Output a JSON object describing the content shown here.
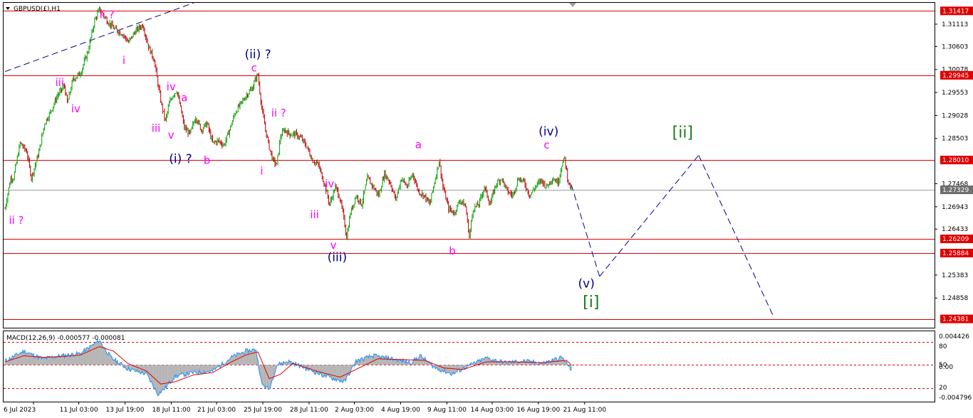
{
  "symbol_title": "GBPUSD(£),H1",
  "colors": {
    "bull": "#00a000",
    "bear": "#c00000",
    "level": "#e00000",
    "current": "#a0a0a0",
    "wave_blue": "#00008b",
    "wave_pink": "#ff00ff",
    "wave_green": "#1a7a1a",
    "projection": "#00008b",
    "macd_hist": "#b4b4b4",
    "macd_signal": "#e00000",
    "macd_line": "#1e90ff"
  },
  "chart_data": [
    {
      "type": "candlestick",
      "symbol": "GBPUSD(£),H1",
      "ylim": [
        1.2418,
        1.316
      ],
      "x_ticks": [
        "6 Jul 2023",
        "11 Jul 03:00",
        "13 Jul 19:00",
        "18 Jul 11:00",
        "21 Jul 03:00",
        "25 Jul 19:00",
        "28 Jul 11:00",
        "2 Aug 03:00",
        "4 Aug 19:00",
        "9 Aug 11:00",
        "14 Aug 03:00",
        "16 Aug 19:00",
        "21 Aug 11:00"
      ],
      "y_ticks": [
        "1.31113",
        "1.30603",
        "1.30078",
        "1.29553",
        "1.29028",
        "1.28503",
        "1.27468",
        "1.26943",
        "1.26433",
        "1.25383",
        "1.24858"
      ],
      "levels": [
        {
          "price": 1.31417,
          "label": "1.31417"
        },
        {
          "price": 1.29945,
          "label": "1.29945"
        },
        {
          "price": 1.2801,
          "label": "1.28010"
        },
        {
          "price": 1.26209,
          "label": "1.26209"
        },
        {
          "price": 1.25884,
          "label": "1.25884"
        },
        {
          "price": 1.24381,
          "label": "1.24381"
        }
      ],
      "current_price": {
        "price": 1.27329,
        "label": "1.27329"
      },
      "path_points": [
        {
          "i": 0,
          "price": 1.269
        },
        {
          "i": 6,
          "price": 1.276
        },
        {
          "i": 9,
          "price": 1.276
        },
        {
          "i": 16,
          "price": 1.284
        },
        {
          "i": 23,
          "price": 1.282
        },
        {
          "i": 28,
          "price": 1.276
        },
        {
          "i": 36,
          "price": 1.282
        },
        {
          "i": 42,
          "price": 1.2885
        },
        {
          "i": 48,
          "price": 1.291
        },
        {
          "i": 56,
          "price": 1.295
        },
        {
          "i": 63,
          "price": 1.297
        },
        {
          "i": 66,
          "price": 1.293
        },
        {
          "i": 72,
          "price": 1.2985
        },
        {
          "i": 80,
          "price": 1.3
        },
        {
          "i": 88,
          "price": 1.305
        },
        {
          "i": 95,
          "price": 1.312
        },
        {
          "i": 100,
          "price": 1.3145
        },
        {
          "i": 108,
          "price": 1.312
        },
        {
          "i": 116,
          "price": 1.31
        },
        {
          "i": 124,
          "price": 1.309
        },
        {
          "i": 131,
          "price": 1.307
        },
        {
          "i": 138,
          "price": 1.3095
        },
        {
          "i": 146,
          "price": 1.311
        },
        {
          "i": 152,
          "price": 1.306
        },
        {
          "i": 158,
          "price": 1.303
        },
        {
          "i": 162,
          "price": 1.2975
        },
        {
          "i": 166,
          "price": 1.2925
        },
        {
          "i": 170,
          "price": 1.289
        },
        {
          "i": 174,
          "price": 1.293
        },
        {
          "i": 178,
          "price": 1.295
        },
        {
          "i": 182,
          "price": 1.296
        },
        {
          "i": 186,
          "price": 1.292
        },
        {
          "i": 190,
          "price": 1.2875
        },
        {
          "i": 196,
          "price": 1.286
        },
        {
          "i": 202,
          "price": 1.29
        },
        {
          "i": 208,
          "price": 1.287
        },
        {
          "i": 214,
          "price": 1.2885
        },
        {
          "i": 220,
          "price": 1.284
        },
        {
          "i": 226,
          "price": 1.2845
        },
        {
          "i": 232,
          "price": 1.2835
        },
        {
          "i": 238,
          "price": 1.287
        },
        {
          "i": 244,
          "price": 1.291
        },
        {
          "i": 250,
          "price": 1.293
        },
        {
          "i": 256,
          "price": 1.295
        },
        {
          "i": 262,
          "price": 1.2965
        },
        {
          "i": 266,
          "price": 1.299
        },
        {
          "i": 268,
          "price": 1.2995
        },
        {
          "i": 272,
          "price": 1.292
        },
        {
          "i": 276,
          "price": 1.287
        },
        {
          "i": 280,
          "price": 1.283
        },
        {
          "i": 284,
          "price": 1.28
        },
        {
          "i": 288,
          "price": 1.279
        },
        {
          "i": 292,
          "price": 1.2855
        },
        {
          "i": 296,
          "price": 1.287
        },
        {
          "i": 302,
          "price": 1.286
        },
        {
          "i": 308,
          "price": 1.286
        },
        {
          "i": 314,
          "price": 1.285
        },
        {
          "i": 320,
          "price": 1.283
        },
        {
          "i": 326,
          "price": 1.28
        },
        {
          "i": 332,
          "price": 1.279
        },
        {
          "i": 338,
          "price": 1.275
        },
        {
          "i": 344,
          "price": 1.27
        },
        {
          "i": 350,
          "price": 1.274
        },
        {
          "i": 354,
          "price": 1.272
        },
        {
          "i": 358,
          "price": 1.268
        },
        {
          "i": 362,
          "price": 1.2625
        },
        {
          "i": 366,
          "price": 1.268
        },
        {
          "i": 372,
          "price": 1.272
        },
        {
          "i": 378,
          "price": 1.27
        },
        {
          "i": 384,
          "price": 1.276
        },
        {
          "i": 390,
          "price": 1.274
        },
        {
          "i": 396,
          "price": 1.272
        },
        {
          "i": 402,
          "price": 1.277
        },
        {
          "i": 408,
          "price": 1.275
        },
        {
          "i": 414,
          "price": 1.271
        },
        {
          "i": 420,
          "price": 1.276
        },
        {
          "i": 426,
          "price": 1.274
        },
        {
          "i": 432,
          "price": 1.277
        },
        {
          "i": 438,
          "price": 1.273
        },
        {
          "i": 444,
          "price": 1.272
        },
        {
          "i": 450,
          "price": 1.27
        },
        {
          "i": 456,
          "price": 1.276
        },
        {
          "i": 460,
          "price": 1.28
        },
        {
          "i": 464,
          "price": 1.274
        },
        {
          "i": 470,
          "price": 1.269
        },
        {
          "i": 476,
          "price": 1.268
        },
        {
          "i": 482,
          "price": 1.271
        },
        {
          "i": 488,
          "price": 1.2695
        },
        {
          "i": 492,
          "price": 1.2625
        },
        {
          "i": 496,
          "price": 1.269
        },
        {
          "i": 502,
          "price": 1.27
        },
        {
          "i": 508,
          "price": 1.274
        },
        {
          "i": 514,
          "price": 1.27
        },
        {
          "i": 520,
          "price": 1.2745
        },
        {
          "i": 526,
          "price": 1.276
        },
        {
          "i": 532,
          "price": 1.273
        },
        {
          "i": 538,
          "price": 1.272
        },
        {
          "i": 544,
          "price": 1.276
        },
        {
          "i": 550,
          "price": 1.275
        },
        {
          "i": 556,
          "price": 1.272
        },
        {
          "i": 562,
          "price": 1.274
        },
        {
          "i": 568,
          "price": 1.2755
        },
        {
          "i": 574,
          "price": 1.274
        },
        {
          "i": 580,
          "price": 1.276
        },
        {
          "i": 586,
          "price": 1.275
        },
        {
          "i": 590,
          "price": 1.279
        },
        {
          "i": 593,
          "price": 1.2805
        },
        {
          "i": 596,
          "price": 1.276
        },
        {
          "i": 598,
          "price": 1.2745
        },
        {
          "i": 600,
          "price": 1.2733
        }
      ],
      "projection": [
        {
          "i": 600,
          "price": 1.2745
        },
        {
          "i": 630,
          "price": 1.2535
        },
        {
          "i": 735,
          "price": 1.2812
        },
        {
          "i": 815,
          "price": 1.244
        }
      ],
      "trendline": [
        {
          "i": 0,
          "price": 1.3003
        },
        {
          "i": 200,
          "price": 1.316
        }
      ],
      "wave_labels": [
        {
          "text": "ii ?",
          "i": 108,
          "price": 1.3125,
          "color": "pink",
          "size": "small"
        },
        {
          "text": "i",
          "i": 126,
          "price": 1.302,
          "color": "pink",
          "size": "small"
        },
        {
          "text": "iii",
          "i": 58,
          "price": 1.297,
          "color": "pink",
          "size": "small"
        },
        {
          "text": "iv",
          "i": 75,
          "price": 1.291,
          "color": "pink",
          "size": "small"
        },
        {
          "text": "ii ?",
          "i": 12,
          "price": 1.2655,
          "color": "pink",
          "size": "small"
        },
        {
          "text": "iv",
          "i": 176,
          "price": 1.296,
          "color": "pink",
          "size": "small"
        },
        {
          "text": "iii",
          "i": 160,
          "price": 1.2865,
          "color": "pink",
          "size": "small"
        },
        {
          "text": "v",
          "i": 176,
          "price": 1.285,
          "color": "pink",
          "size": "small"
        },
        {
          "text": "a",
          "i": 190,
          "price": 1.2935,
          "color": "pink",
          "size": "small"
        },
        {
          "text": "b",
          "i": 214,
          "price": 1.2792,
          "color": "pink",
          "size": "small"
        },
        {
          "text": "(i) ?",
          "i": 186,
          "price": 1.2795,
          "color": "blue",
          "size": "large"
        },
        {
          "text": "(ii) ?",
          "i": 268,
          "price": 1.3033,
          "color": "blue",
          "size": "large"
        },
        {
          "text": "c",
          "i": 264,
          "price": 1.3003,
          "color": "pink",
          "size": "small"
        },
        {
          "text": "ii ?",
          "i": 290,
          "price": 1.29,
          "color": "pink",
          "size": "small"
        },
        {
          "text": "i",
          "i": 272,
          "price": 1.2768,
          "color": "pink",
          "size": "small"
        },
        {
          "text": "iv",
          "i": 344,
          "price": 1.2739,
          "color": "pink",
          "size": "small"
        },
        {
          "text": "iii",
          "i": 328,
          "price": 1.2668,
          "color": "pink",
          "size": "small"
        },
        {
          "text": "v",
          "i": 348,
          "price": 1.2598,
          "color": "pink",
          "size": "small"
        },
        {
          "text": "(iii)",
          "i": 352,
          "price": 1.257,
          "color": "blue",
          "size": "large"
        },
        {
          "text": "a",
          "i": 438,
          "price": 1.2828,
          "color": "pink",
          "size": "small"
        },
        {
          "text": "b",
          "i": 474,
          "price": 1.2585,
          "color": "pink",
          "size": "small"
        },
        {
          "text": "(iv)",
          "i": 576,
          "price": 1.2857,
          "color": "blue",
          "size": "large"
        },
        {
          "text": "c",
          "i": 574,
          "price": 1.2827,
          "color": "pink",
          "size": "small"
        },
        {
          "text": "(v)",
          "i": 616,
          "price": 1.251,
          "color": "blue",
          "size": "large"
        },
        {
          "text": "[i]",
          "i": 621,
          "price": 1.2465,
          "color": "green",
          "size": "xlarge"
        },
        {
          "text": "[ii]",
          "i": 718,
          "price": 1.2852,
          "color": "green",
          "size": "xlarge"
        }
      ]
    },
    {
      "type": "macd",
      "title": "MACD(12,26,9) -0.000577 -0.000081",
      "ylim": [
        -0.0048,
        0.0044
      ],
      "y_ticks": [
        "0.004426",
        "80",
        "50",
        "0.00",
        "20",
        "-0.004796"
      ],
      "dashed_levels": [
        0.003,
        0.0,
        -0.003
      ],
      "macd_points": [
        {
          "i": 0,
          "v": 0.0005
        },
        {
          "i": 20,
          "v": 0.0018
        },
        {
          "i": 40,
          "v": 0.0008
        },
        {
          "i": 60,
          "v": 0.0012
        },
        {
          "i": 80,
          "v": 0.0015
        },
        {
          "i": 100,
          "v": 0.0032
        },
        {
          "i": 112,
          "v": 0.001
        },
        {
          "i": 130,
          "v": -0.0005
        },
        {
          "i": 150,
          "v": -0.0012
        },
        {
          "i": 162,
          "v": -0.0038
        },
        {
          "i": 170,
          "v": -0.003
        },
        {
          "i": 180,
          "v": -0.0015
        },
        {
          "i": 200,
          "v": -0.001
        },
        {
          "i": 220,
          "v": -0.0008
        },
        {
          "i": 240,
          "v": 0.001
        },
        {
          "i": 255,
          "v": 0.0018
        },
        {
          "i": 266,
          "v": 0.002
        },
        {
          "i": 272,
          "v": -0.0025
        },
        {
          "i": 280,
          "v": -0.0032
        },
        {
          "i": 288,
          "v": 0.0
        },
        {
          "i": 300,
          "v": 0.0005
        },
        {
          "i": 320,
          "v": -0.0005
        },
        {
          "i": 340,
          "v": -0.0015
        },
        {
          "i": 360,
          "v": -0.0022
        },
        {
          "i": 372,
          "v": 0.0005
        },
        {
          "i": 390,
          "v": 0.0012
        },
        {
          "i": 410,
          "v": 0.0008
        },
        {
          "i": 430,
          "v": 0.0003
        },
        {
          "i": 440,
          "v": 0.0012
        },
        {
          "i": 456,
          "v": -0.0004
        },
        {
          "i": 474,
          "v": -0.0012
        },
        {
          "i": 490,
          "v": -0.0002
        },
        {
          "i": 510,
          "v": 0.0009
        },
        {
          "i": 530,
          "v": 0.0003
        },
        {
          "i": 550,
          "v": 0.0005
        },
        {
          "i": 570,
          "v": 0.0002
        },
        {
          "i": 590,
          "v": 0.001
        },
        {
          "i": 600,
          "v": -0.0006
        }
      ],
      "signal_points": [
        {
          "i": 0,
          "v": 0.0004
        },
        {
          "i": 20,
          "v": 0.0012
        },
        {
          "i": 40,
          "v": 0.001
        },
        {
          "i": 60,
          "v": 0.0011
        },
        {
          "i": 80,
          "v": 0.0013
        },
        {
          "i": 100,
          "v": 0.0024
        },
        {
          "i": 115,
          "v": 0.0018
        },
        {
          "i": 130,
          "v": 0.0002
        },
        {
          "i": 150,
          "v": -0.0008
        },
        {
          "i": 165,
          "v": -0.0025
        },
        {
          "i": 180,
          "v": -0.0022
        },
        {
          "i": 200,
          "v": -0.0013
        },
        {
          "i": 220,
          "v": -0.001
        },
        {
          "i": 240,
          "v": 0.0004
        },
        {
          "i": 255,
          "v": 0.0013
        },
        {
          "i": 268,
          "v": 0.0017
        },
        {
          "i": 280,
          "v": -0.0018
        },
        {
          "i": 292,
          "v": -0.0012
        },
        {
          "i": 305,
          "v": 0.0002
        },
        {
          "i": 330,
          "v": -0.0008
        },
        {
          "i": 355,
          "v": -0.0016
        },
        {
          "i": 375,
          "v": -0.0004
        },
        {
          "i": 395,
          "v": 0.0008
        },
        {
          "i": 420,
          "v": 0.0007
        },
        {
          "i": 445,
          "v": 0.0006
        },
        {
          "i": 465,
          "v": -0.0004
        },
        {
          "i": 485,
          "v": -0.0006
        },
        {
          "i": 510,
          "v": 0.0004
        },
        {
          "i": 540,
          "v": 0.0004
        },
        {
          "i": 570,
          "v": 0.0003
        },
        {
          "i": 595,
          "v": 0.0006
        },
        {
          "i": 600,
          "v": 0.0
        }
      ]
    }
  ]
}
